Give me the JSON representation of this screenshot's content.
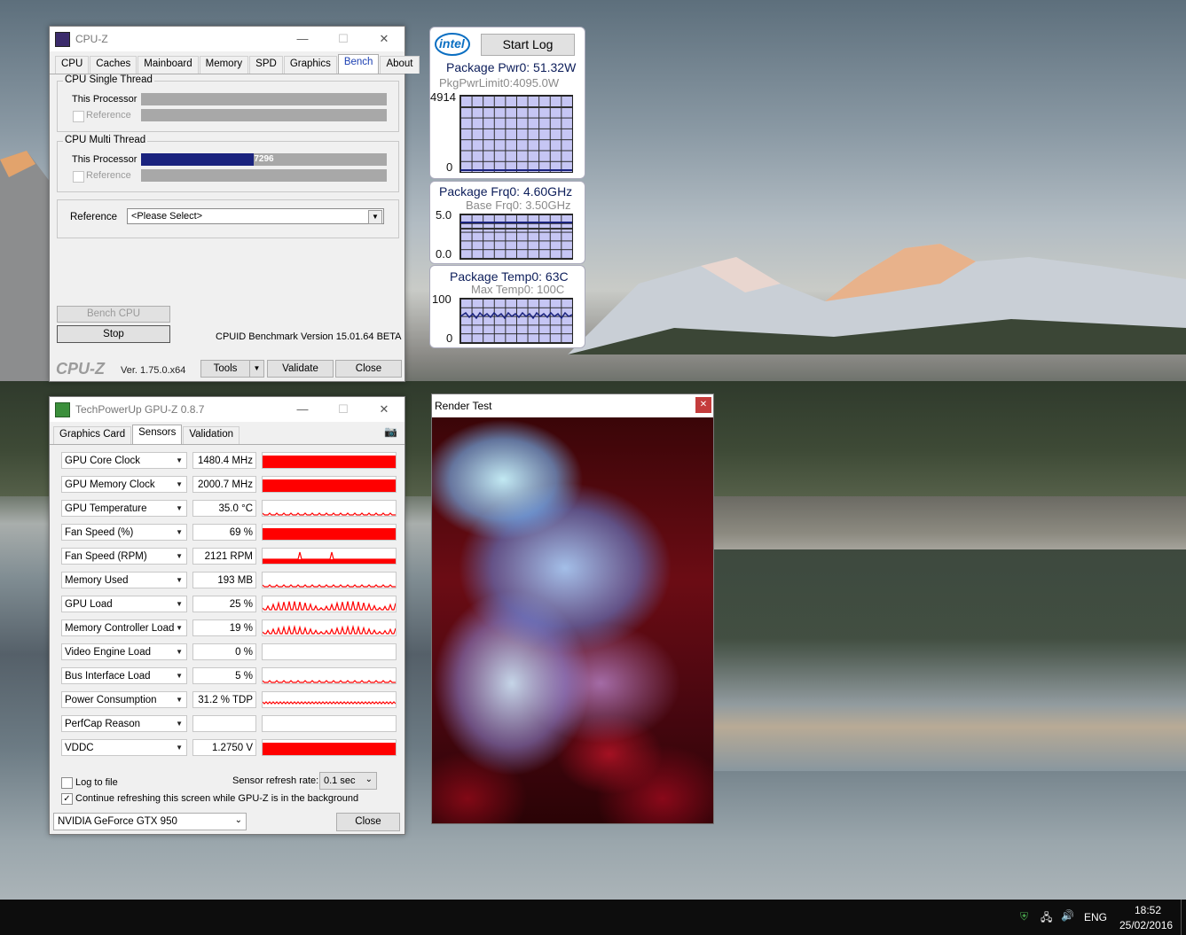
{
  "cpuz": {
    "title": "CPU-Z",
    "tabs": [
      "CPU",
      "Caches",
      "Mainboard",
      "Memory",
      "SPD",
      "Graphics",
      "Bench",
      "About"
    ],
    "active_tab": "Bench",
    "single_group": "CPU Single Thread",
    "multi_group": "CPU Multi Thread",
    "this_processor": "This Processor",
    "reference": "Reference",
    "multi_score": "7296",
    "multi_progress": 0.46,
    "reference_label": "Reference",
    "reference_select": "<Please Select>",
    "bench_cpu": "Bench CPU",
    "stop": "Stop",
    "version_note": "CPUID Benchmark Version 15.01.64 BETA",
    "logo": "CPU-Z",
    "ver": "Ver. 1.75.0.x64",
    "tools": "Tools",
    "validate": "Validate",
    "close": "Close"
  },
  "intel": {
    "logo": "intel",
    "start_log": "Start Log",
    "pwr_title": "Package Pwr0: 51.32W",
    "pwr_sub": "PkgPwrLimit0:4095.0W",
    "pwr_max": "4914",
    "pwr_min": "0",
    "frq_title": "Package Frq0:  4.60GHz",
    "frq_sub": "Base Frq0: 3.50GHz",
    "frq_max": "5.0",
    "frq_min": "0.0",
    "temp_title": "Package Temp0:  63C",
    "temp_sub": "Max Temp0: 100C",
    "temp_max": "100",
    "temp_min": "0"
  },
  "gpuz": {
    "title": "TechPowerUp GPU-Z 0.8.7",
    "tabs": [
      "Graphics Card",
      "Sensors",
      "Validation"
    ],
    "active_tab": "Sensors",
    "sensors": [
      {
        "name": "GPU Core Clock",
        "value": "1480.4 MHz",
        "level": 0.9
      },
      {
        "name": "GPU Memory Clock",
        "value": "2000.7 MHz",
        "level": 0.9
      },
      {
        "name": "GPU Temperature",
        "value": "35.0 °C",
        "level": 0.1
      },
      {
        "name": "Fan Speed (%)",
        "value": "69 %",
        "level": 0.69
      },
      {
        "name": "Fan Speed (RPM)",
        "value": "2121 RPM",
        "level": 0.4
      },
      {
        "name": "Memory Used",
        "value": "193 MB",
        "level": 0.05
      },
      {
        "name": "GPU Load",
        "value": "25 %",
        "level": 0.25
      },
      {
        "name": "Memory Controller Load",
        "value": "19 %",
        "level": 0.19
      },
      {
        "name": "Video Engine Load",
        "value": "0 %",
        "level": 0
      },
      {
        "name": "Bus Interface Load",
        "value": "5 %",
        "level": 0.05
      },
      {
        "name": "Power Consumption",
        "value": "31.2 % TDP",
        "level": 0.31
      },
      {
        "name": "PerfCap Reason",
        "value": "",
        "level": 0
      },
      {
        "name": "VDDC",
        "value": "1.2750 V",
        "level": 0.9
      }
    ],
    "log_to_file": "Log to file",
    "refresh_label": "Sensor refresh rate:",
    "refresh_value": "0.1 sec",
    "continue_refresh": "Continue refreshing this screen while GPU-Z is in the background",
    "gpu_select": "NVIDIA GeForce GTX 950",
    "close": "Close"
  },
  "render": {
    "title": "Render Test"
  },
  "taskbar": {
    "lang": "ENG",
    "time": "18:52",
    "date": "25/02/2016"
  }
}
